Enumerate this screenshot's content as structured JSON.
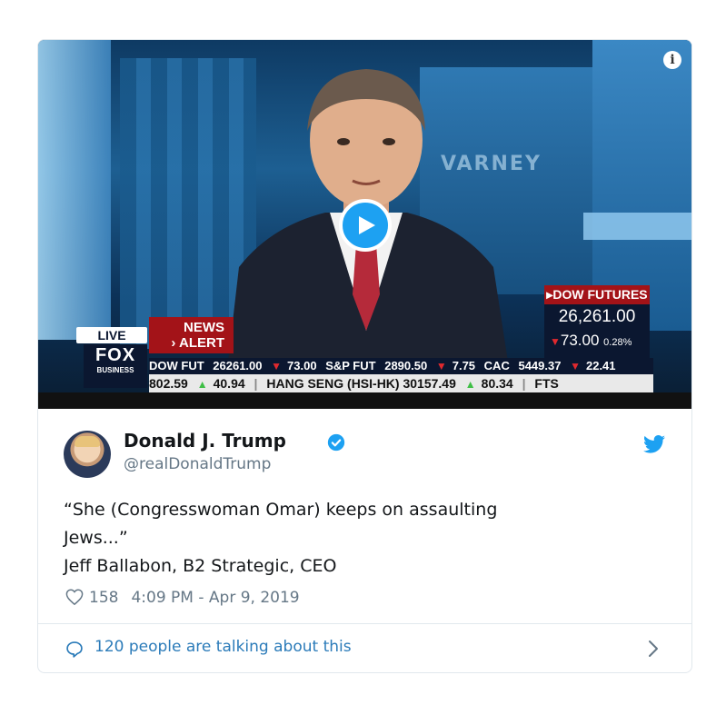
{
  "video": {
    "info_glyph": "i",
    "background_text": "VARNEY",
    "dow_box": {
      "title": "▸DOW FUTURES",
      "value": "26,261.00",
      "change": "73.00",
      "change_pct": "0.28%"
    },
    "live_label": "LIVE",
    "news_alert_line1": "NEWS",
    "news_alert_line2": "› ALERT",
    "logo_text": "FOX",
    "logo_sub": "BUSINESS",
    "ticker_top": [
      {
        "label": "DOW FUT",
        "value": "26261.00",
        "change": "73.00"
      },
      {
        "label": "S&P FUT",
        "value": "2890.50",
        "change": "7.75"
      },
      {
        "label": "CAC",
        "value": "5449.37",
        "change": "22.41"
      }
    ],
    "ticker_bottom": {
      "first_value": "802.59",
      "first_change": "40.94",
      "hang_seng": "HANG SENG (HSI-HK) 30157.49",
      "hang_seng_change": "80.34",
      "tail": "FTS"
    }
  },
  "tweet": {
    "author_name": "Donald J. Trump",
    "handle": "@realDonaldTrump",
    "text_line1": "“She (Congresswoman Omar) keeps on assaulting",
    "text_line2": "Jews...”",
    "text_line3": "Jeff Ballabon, B2 Strategic, CEO",
    "likes": "158",
    "timestamp": "4:09 PM - Apr 9, 2019"
  },
  "footer": {
    "talking": "120 people are talking about this"
  },
  "icons": [
    "info-icon",
    "play-icon",
    "verified-icon",
    "twitter-bird-icon",
    "heart-icon",
    "speech-bubble-icon",
    "chevron-right-icon"
  ],
  "colors": {
    "twitter_blue": "#1da1f2",
    "link_blue": "#2b7bb9",
    "secondary_text": "#657786",
    "fox_red": "#a31318",
    "border": "#e1e8ed"
  }
}
